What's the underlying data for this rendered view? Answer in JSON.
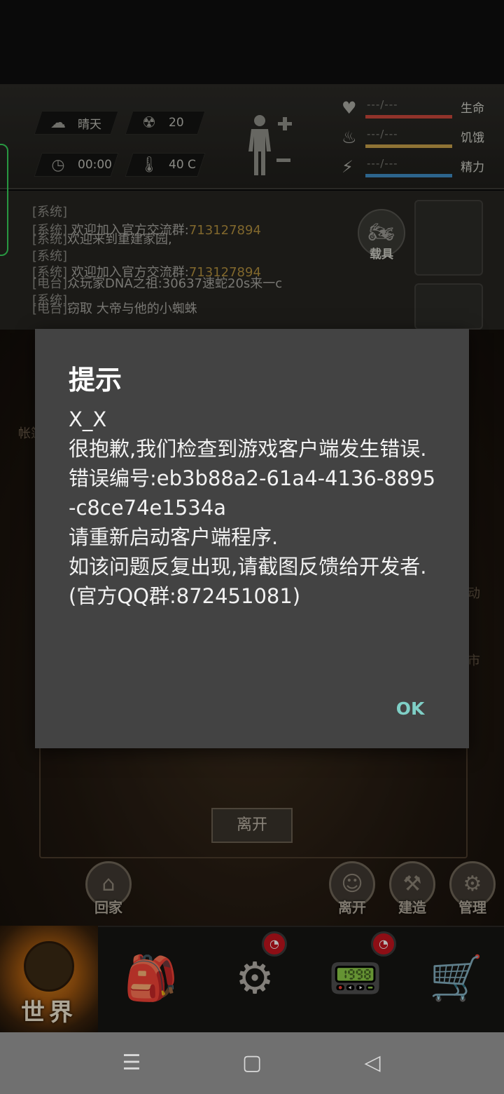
{
  "hud": {
    "weather": "晴天",
    "radiation": "20",
    "time": "00:00",
    "temperature": "40 C",
    "vitals": [
      {
        "label": "生命",
        "value": "---/---",
        "bar_color": "#c9473b"
      },
      {
        "label": "饥饿",
        "value": "---/---",
        "bar_color": "#c7a04a"
      },
      {
        "label": "精力",
        "value": "---/---",
        "bar_color": "#3f8cc4"
      }
    ],
    "vehicle_label": "载具"
  },
  "chat": {
    "lines": [
      {
        "tag": "[系统]",
        "text": "",
        "num": ""
      },
      {
        "tag": "[系统]",
        "text": "  欢迎加入官方交流群:",
        "num": "713127894"
      },
      {
        "tag": "[系统]",
        "text": "欢迎来到重建家园,",
        "num": ""
      },
      {
        "tag": "[系统]",
        "text": "",
        "num": ""
      },
      {
        "tag": "[系统]",
        "text": "  欢迎加入官方交流群:",
        "num": "713127894"
      },
      {
        "tag": "[电台]",
        "text": "众玩家DNA之祖:30637速蛇20s来一c",
        "num": ""
      },
      {
        "tag": "[系统]",
        "text": "",
        "num": ""
      },
      {
        "tag": "[电台]",
        "text": "窃取 大帝与他的小蜘蛛",
        "num": ""
      }
    ]
  },
  "scene": {
    "leave_label": "离开",
    "side_left": "帐篷",
    "side_right_1": "动",
    "side_right_2": "市",
    "buttons": [
      {
        "label": "回家",
        "icon": "home-icon"
      },
      {
        "label": "离开",
        "icon": "person-exit-icon"
      },
      {
        "label": "建造",
        "icon": "build-icon"
      },
      {
        "label": "管理",
        "icon": "house-gear-icon"
      }
    ]
  },
  "bottom_nav": {
    "world_label": "世界",
    "items": [
      "backpack-icon",
      "head-gears-icon",
      "walkie-talkie-icon",
      "cart-icon"
    ]
  },
  "dialog": {
    "title": "提示",
    "message": "X_X\n很抱歉,我们检查到游戏客户端发生错误.\n错误编号:eb3b88a2-61a4-4136-8895-c8ce74e1534a\n请重新启动客户端程序.\n如该问题反复出现,请截图反馈给开发者.\n(官方QQ群:872451081)",
    "ok_label": "OK"
  },
  "colors": {
    "dialog_bg": "#434343",
    "ok_accent": "#7fcfc6"
  }
}
